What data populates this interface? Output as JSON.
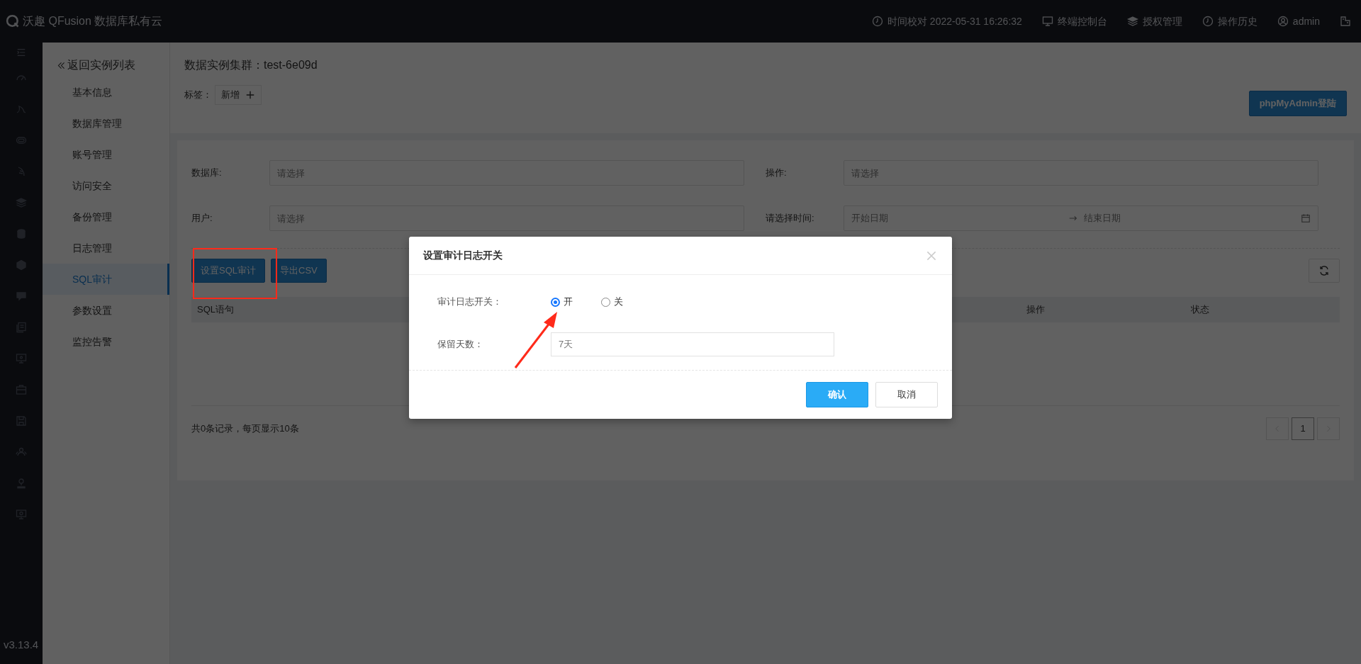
{
  "header": {
    "logo_text": "沃趣 QFusion 数据库私有云",
    "items": [
      {
        "kind": "clock",
        "label": "时间校对 2022-05-31 16:26:32"
      },
      {
        "kind": "monitor",
        "label": "终端控制台"
      },
      {
        "kind": "layers",
        "label": "授权管理"
      },
      {
        "kind": "history",
        "label": "操作历史"
      },
      {
        "kind": "user",
        "label": "admin"
      }
    ]
  },
  "rail": {
    "version": "v3.13.4"
  },
  "subnav": {
    "back": "返回实例列表",
    "items": [
      {
        "label": "基本信息",
        "selected": false
      },
      {
        "label": "数据库管理",
        "selected": false
      },
      {
        "label": "账号管理",
        "selected": false
      },
      {
        "label": "访问安全",
        "selected": false
      },
      {
        "label": "备份管理",
        "selected": false
      },
      {
        "label": "日志管理",
        "selected": false
      },
      {
        "label": "SQL审计",
        "selected": true
      },
      {
        "label": "参数设置",
        "selected": false
      },
      {
        "label": "监控告警",
        "selected": false
      }
    ]
  },
  "page": {
    "title": "数据实例集群：test-6e09d",
    "tags_label": "标签：",
    "tag_add": "新增",
    "login_button": "phpMyAdmin登陆"
  },
  "filters": [
    {
      "kind": "select",
      "label": "数据库:",
      "placeholder": "请选择"
    },
    {
      "kind": "select",
      "label": "操作:",
      "placeholder": "请选择"
    },
    {
      "kind": "select",
      "label": "用户:",
      "placeholder": "请选择"
    },
    {
      "kind": "daterange",
      "label": "请选择时间:",
      "start_placeholder": "开始日期",
      "end_placeholder": "结束日期"
    }
  ],
  "toolbar": {
    "buttons": [
      "设置SQL审计",
      "导出CSV"
    ]
  },
  "table": {
    "columns": [
      "SQL语句",
      "操作",
      "状态"
    ]
  },
  "pagination": {
    "summary": "共0条记录，每页显示10条",
    "pages": [
      {
        "label": "1",
        "selected": true
      }
    ]
  },
  "modal": {
    "title": "设置审计日志开关",
    "fields": [
      {
        "kind": "radio",
        "label": "审计日志开关：",
        "options": [
          {
            "label": "开",
            "selected": true
          },
          {
            "label": "关",
            "selected": false
          }
        ]
      },
      {
        "kind": "input",
        "label": "保留天数：",
        "value": "7天"
      }
    ],
    "buttons": [
      {
        "kind": "primary",
        "label": "确认"
      },
      {
        "kind": "default",
        "label": "取消"
      }
    ]
  }
}
